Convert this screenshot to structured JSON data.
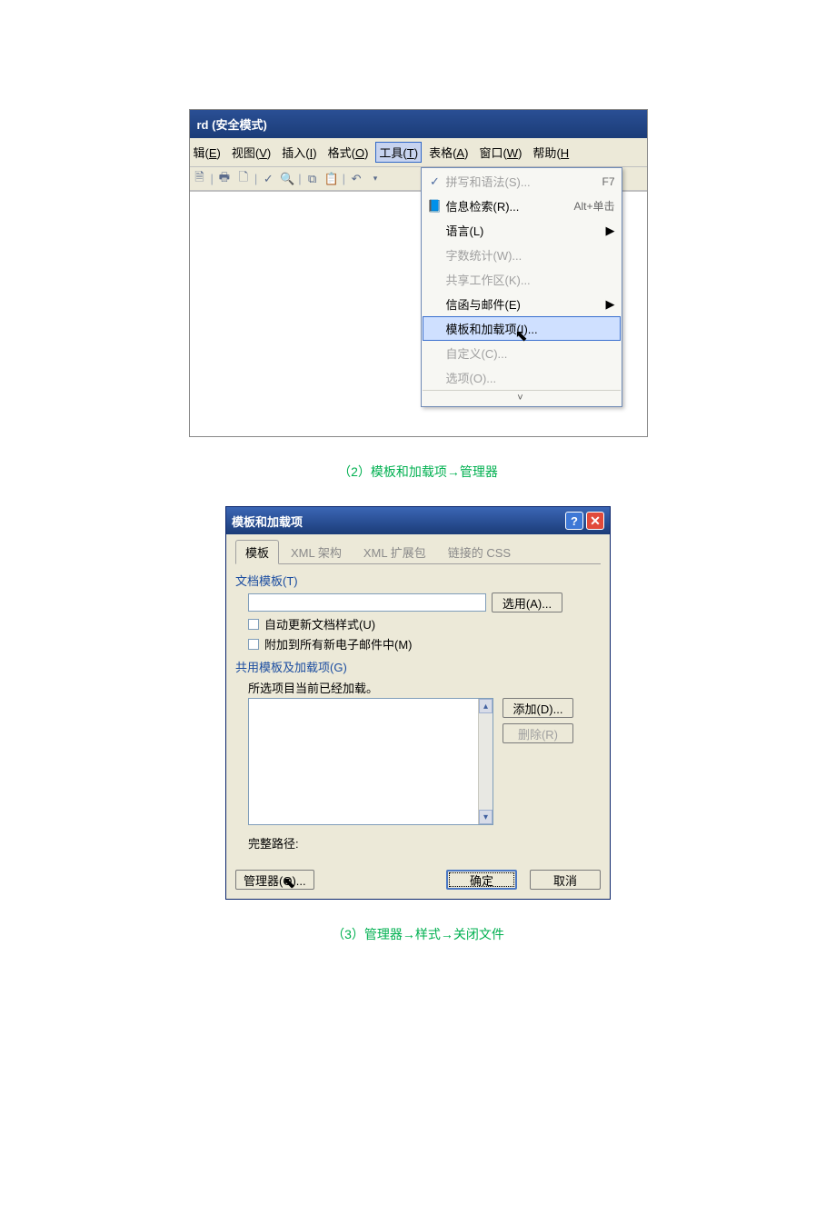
{
  "shot1": {
    "title": "rd (安全模式)",
    "menubar": [
      {
        "label": "辑",
        "accel": "E"
      },
      {
        "label": "视图",
        "accel": "V"
      },
      {
        "label": "插入",
        "accel": "I"
      },
      {
        "label": "格式",
        "accel": "O"
      },
      {
        "label": "工具",
        "accel": "T",
        "active": true
      },
      {
        "label": "表格",
        "accel": "A"
      },
      {
        "label": "窗口",
        "accel": "W"
      },
      {
        "label": "帮助",
        "accel": "H"
      }
    ],
    "dropdown": [
      {
        "ico": "✓",
        "label": "拼写和语法(S)...",
        "shortcut": "F7",
        "disabled": true
      },
      {
        "ico": "🔍",
        "label": "信息检索(R)...",
        "shortcut": "Alt+单击"
      },
      {
        "label": "语言(L)",
        "submenu": true
      },
      {
        "label": "字数统计(W)...",
        "disabled": true
      },
      {
        "label": "共享工作区(K)...",
        "disabled": true
      },
      {
        "label": "信函与邮件(E)",
        "submenu": true
      },
      {
        "label": "模板和加载项(I)...",
        "hover": true
      },
      {
        "label": "自定义(C)...",
        "disabled": true
      },
      {
        "label": "选项(O)...",
        "disabled": true
      }
    ],
    "expand_glyph": "˅"
  },
  "caption1": "（2）模板和加载项→管理器",
  "shot2": {
    "title": "模板和加载项",
    "tabs": [
      "模板",
      "XML 架构",
      "XML 扩展包",
      "链接的 CSS"
    ],
    "doc_template_heading": "文档模板(T)",
    "select_btn": "选用(A)...",
    "chk_auto_update": "自动更新文档样式(U)",
    "chk_attach_email": "附加到所有新电子邮件中(M)",
    "shared_heading": "共用模板及加载项(G)",
    "loaded_note": "所选项目当前已经加载。",
    "add_btn": "添加(D)...",
    "remove_btn": "删除(R)",
    "full_path_label": "完整路径:",
    "organizer_btn": "管理器(O)...",
    "ok_btn": "确定",
    "cancel_btn": "取消"
  },
  "caption2": "（3）管理器→样式→关闭文件"
}
